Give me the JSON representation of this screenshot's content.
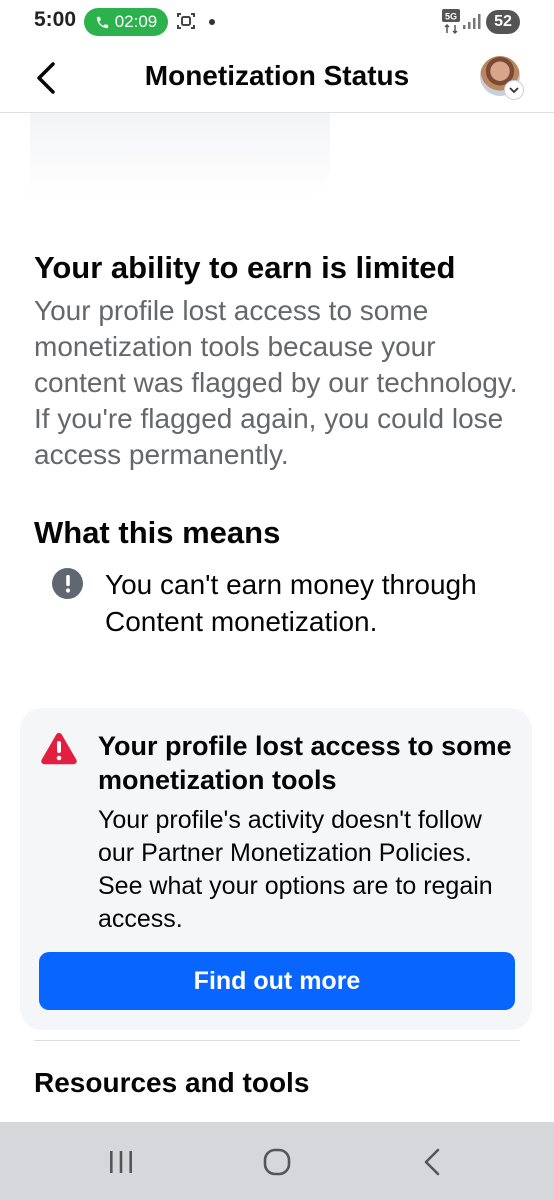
{
  "status_bar": {
    "time": "5:00",
    "call_timer": "02:09",
    "network": "5G",
    "battery": "52"
  },
  "header": {
    "title": "Monetization Status"
  },
  "limit": {
    "heading": "Your ability to earn is limited",
    "body": "Your profile lost access to some monetization tools because your content was flagged by our technology. If you're flagged again, you could lose access permanently."
  },
  "means": {
    "heading": "What this means",
    "items": [
      {
        "text": "You can't earn money through Content monetization."
      }
    ]
  },
  "warning_card": {
    "title": "Your profile lost access to some monetization tools",
    "body": "Your profile's activity doesn't follow our Partner Monetization Policies. See what your options are to regain access.",
    "button_label": "Find out more",
    "button_color": "#0866ff",
    "icon_color": "#e41e3f"
  },
  "resources": {
    "heading": "Resources and tools"
  },
  "nav_bar": {
    "icons": [
      "recents-icon",
      "home-icon",
      "back-icon"
    ]
  }
}
